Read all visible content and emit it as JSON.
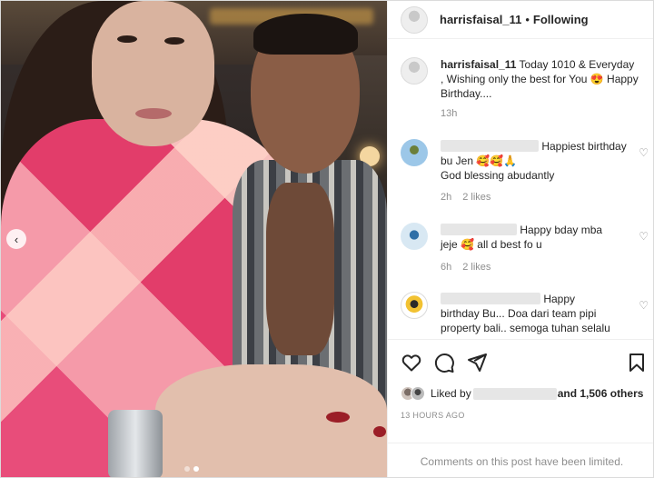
{
  "header": {
    "username": "harrisfaisal_11",
    "separator": "•",
    "follow_status": "Following"
  },
  "caption": {
    "username": "harrisfaisal_11",
    "text": "Today 1010 & Everyday , Wishing only the best for You 😍 Happy Birthday....",
    "time": "13h"
  },
  "comments": [
    {
      "text_line1": "Happiest birthday",
      "text_line2": "bu Jen 🥰🥰🙏",
      "text_line3": "God blessing abudantly",
      "time": "2h",
      "likes": "2 likes"
    },
    {
      "text_line1": "Happy bday mba",
      "text_line2": "jeje 🥰 all d best fo u",
      "time": "6h",
      "likes": "2 likes"
    },
    {
      "text_line1": "Happy",
      "text_line2": "birthday Bu... Doa dari team pipi",
      "text_line3": "property bali.. semoga tuhan selalu"
    }
  ],
  "likes": {
    "prefix": "Liked by",
    "suffix": "and 1,506 others"
  },
  "timestamp": "13 HOURS AGO",
  "limited_notice": "Comments on this post have been limited.",
  "icons": [
    "chevron-left-icon",
    "heart-icon",
    "comment-icon",
    "share-icon",
    "bookmark-icon"
  ],
  "colors": {
    "accent_text": "#262626",
    "muted_text": "#8e8e8e",
    "border": "#dbdbdb"
  }
}
